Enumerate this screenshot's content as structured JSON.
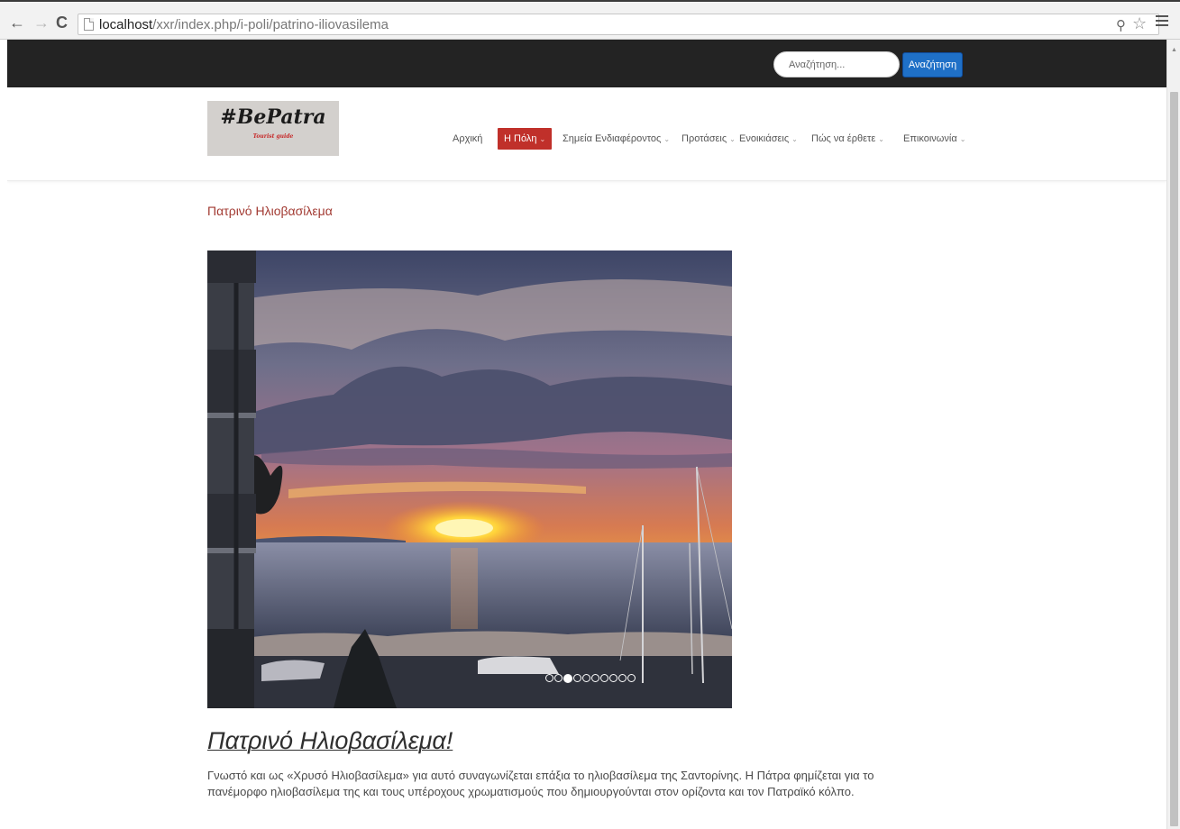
{
  "browser": {
    "url_host": "localhost",
    "url_path": "/xxr/index.php/i-poli/patrino-iliovasilema"
  },
  "topbar": {
    "search_placeholder": "Αναζήτηση...",
    "search_button": "Αναζήτηση"
  },
  "logo": {
    "main": "#BePatra",
    "sub": "Tourist guide"
  },
  "menu": [
    {
      "label": "Αρχική",
      "dropdown": false,
      "active": false
    },
    {
      "label": "Η Πόλη",
      "dropdown": true,
      "active": true
    },
    {
      "label": "Σημεία Ενδιαφέροντος",
      "dropdown": true,
      "active": false
    },
    {
      "label": "Προτάσεις",
      "dropdown": true,
      "active": false
    },
    {
      "label": "Ενοικιάσεις",
      "dropdown": true,
      "active": false
    },
    {
      "label": "Πώς να έρθετε",
      "dropdown": true,
      "active": false
    },
    {
      "label": "Επικοινωνία",
      "dropdown": true,
      "active": false
    }
  ],
  "breadcrumb": "Πατρινό Ηλιοβασίλεμα",
  "slider": {
    "slide_count": 10,
    "active_index": 2
  },
  "article": {
    "title": "Πατρινό Ηλιοβασίλεμα!",
    "body_line1": "Γνωστό και ως «Χρυσό Ηλιοβασίλεμα» για  αυτό συναγωνίζεται  επάξια το ηλιοβασίλεμα της Σαντορίνης. Η Πάτρα φημίζεται για το",
    "body_line2": "πανέμορφο ηλιοβασίλεμα της και τους υπέροχους χρωματισμούς που δημιουργούνται στον ορίζοντα και τον Πατραϊκό κόλπο."
  },
  "colors": {
    "accent": "#c0302a",
    "button_blue": "#1f70c7",
    "topbar": "#232323"
  }
}
